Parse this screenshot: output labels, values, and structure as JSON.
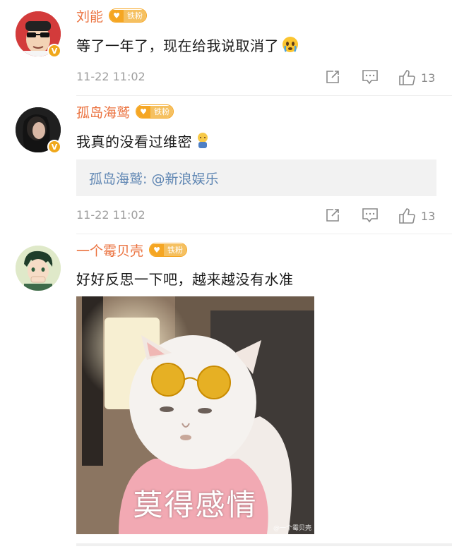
{
  "comments": [
    {
      "user": "刘能",
      "fan_badge": "铁粉",
      "text": "等了一年了，现在给我说取消了",
      "time": "11-22 11:02",
      "likes": "13",
      "avatar": "cartoon-man-avatar"
    },
    {
      "user": "孤岛海鹫",
      "fan_badge": "铁粉",
      "text": "我真的没看过维密",
      "quote": "孤岛海鹫: @新浪娱乐",
      "time": "11-22 11:02",
      "likes": "13",
      "avatar": "woman-photo-avatar"
    },
    {
      "user": "一个霉贝壳",
      "fan_badge": "铁粉",
      "text": "好好反思一下吧，越来越没有水准",
      "image_caption": "莫得感情",
      "image_watermark": "@一个霉贝壳",
      "avatar": "anime-boy-avatar"
    }
  ],
  "colors": {
    "username": "#eb7340",
    "badge": "#f5a623",
    "link": "#5f86b3",
    "meta": "#9e9e9e"
  }
}
